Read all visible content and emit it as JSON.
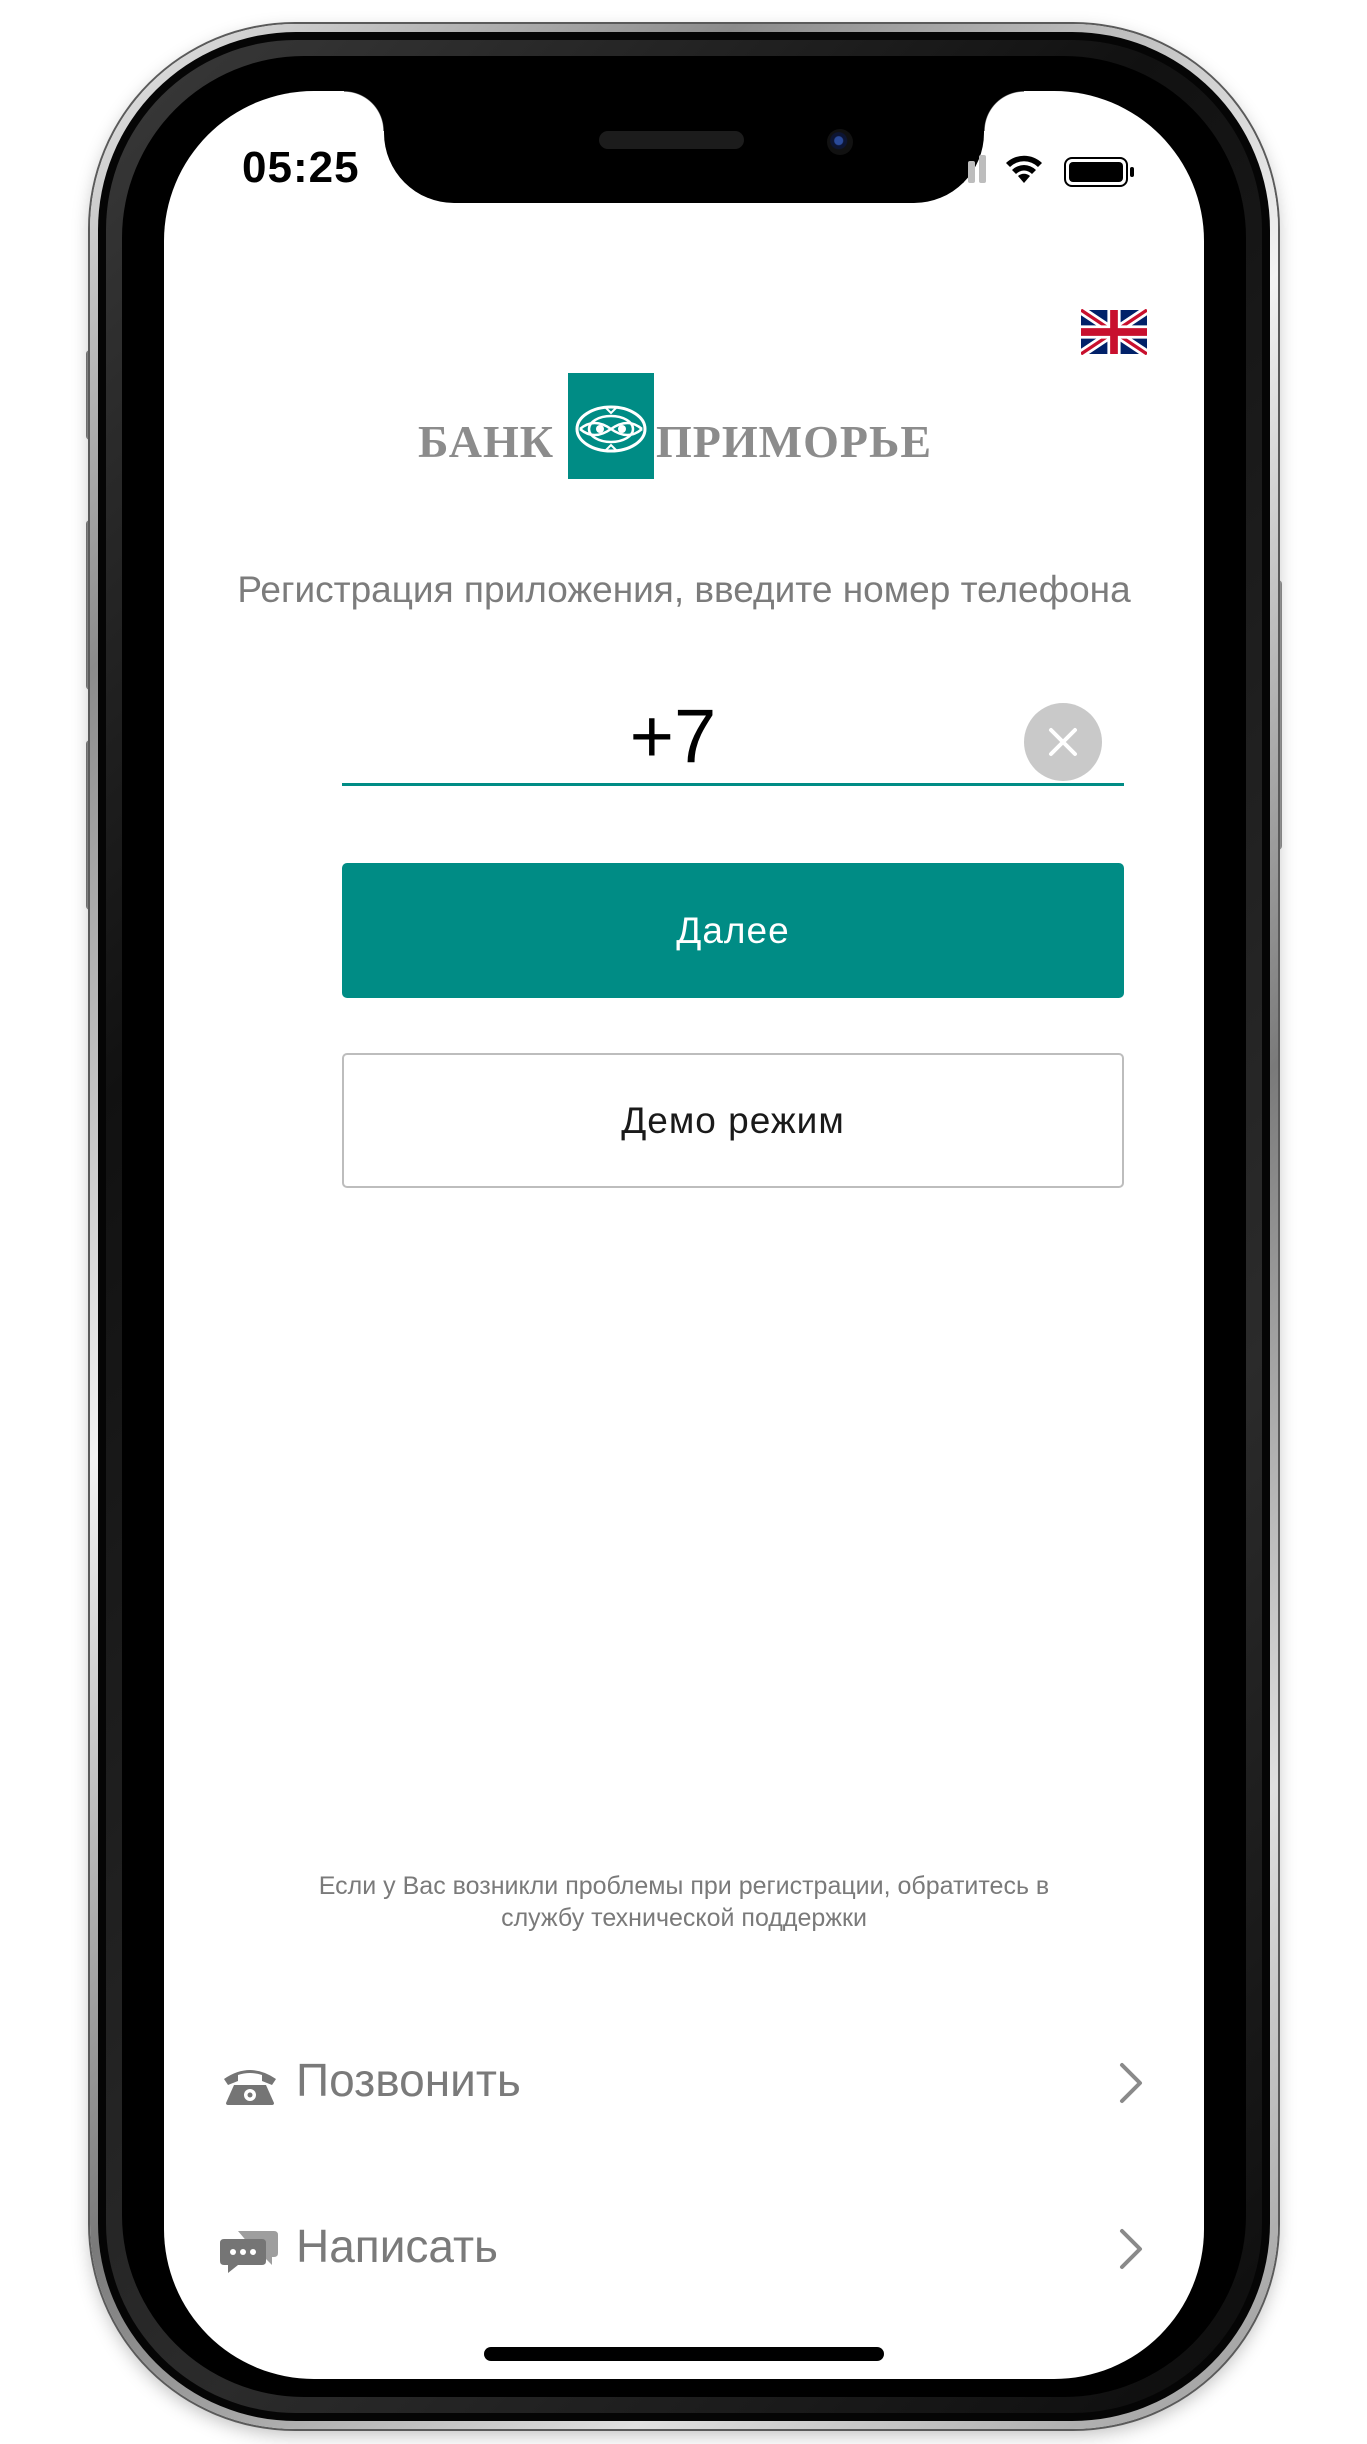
{
  "status_bar": {
    "time": "05:25"
  },
  "language": {
    "flag_icon": "uk-flag-icon"
  },
  "logo": {
    "word_left": "БАНК",
    "word_right": "ПРИМОРЬЕ",
    "brand_color": "#008c85"
  },
  "registration": {
    "subtitle": "Регистрация приложения, введите номер телефона",
    "phone_value": "+7",
    "next_label": "Далее",
    "demo_label": "Демо режим"
  },
  "support": {
    "help_text": "Если у Вас возникли проблемы при регистрации, обратитесь в службу технической поддержки",
    "items": [
      {
        "label": "Позвонить",
        "icon": "phone-icon"
      },
      {
        "label": "Написать",
        "icon": "chat-icon"
      }
    ]
  },
  "colors": {
    "accent": "#008c85",
    "muted_text": "#7a7a7a"
  }
}
